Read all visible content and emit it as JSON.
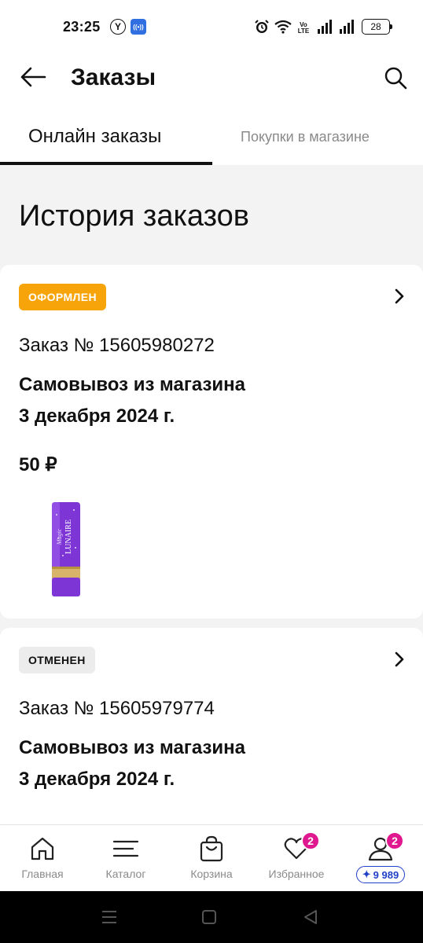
{
  "status_bar": {
    "time": "23:25",
    "yandex_glyph": "Y",
    "nfc_glyph": "((•))",
    "volte_top": "Vo",
    "volte_bottom": "LTE",
    "battery": "28",
    "icons": [
      "yandex-icon",
      "nfc-icon",
      "alarm-icon",
      "wifi-icon",
      "volte-icon",
      "signal-icon",
      "signal-icon",
      "battery-icon"
    ]
  },
  "header": {
    "title": "Заказы",
    "back_icon": "arrow-left-icon",
    "search_icon": "search-icon"
  },
  "tabs": [
    {
      "label": "Онлайн заказы",
      "active": true
    },
    {
      "label": "Покупки в магазине",
      "active": false
    }
  ],
  "section_title": "История заказов",
  "orders": [
    {
      "status": "ОФОРМЛЕН",
      "status_color": "#f7a40a",
      "number": "Заказ № 15605980272",
      "delivery": "Самовывоз из магазина",
      "date": "3 декабря 2024 г.",
      "price": "50 ₽",
      "product_brand": "LUNAIRE",
      "product_script": "Magic"
    },
    {
      "status": "ОТМЕНЕН",
      "status_color": "#ececec",
      "number": "Заказ № 15605979774",
      "delivery": "Самовывоз из магазина",
      "date": "3 декабря 2024 г."
    }
  ],
  "bottom_nav": {
    "items": [
      {
        "label": "Главная",
        "icon": "home-icon"
      },
      {
        "label": "Каталог",
        "icon": "menu-icon"
      },
      {
        "label": "Корзина",
        "icon": "shopping-bag-icon"
      },
      {
        "label": "Избранное",
        "icon": "heart-icon",
        "badge": "2"
      },
      {
        "label": "",
        "icon": "profile-icon",
        "badge": "2"
      }
    ],
    "points_glyph": "✦",
    "points": "9 989",
    "accent_color": "#e0188f",
    "points_color": "#2040c8"
  }
}
